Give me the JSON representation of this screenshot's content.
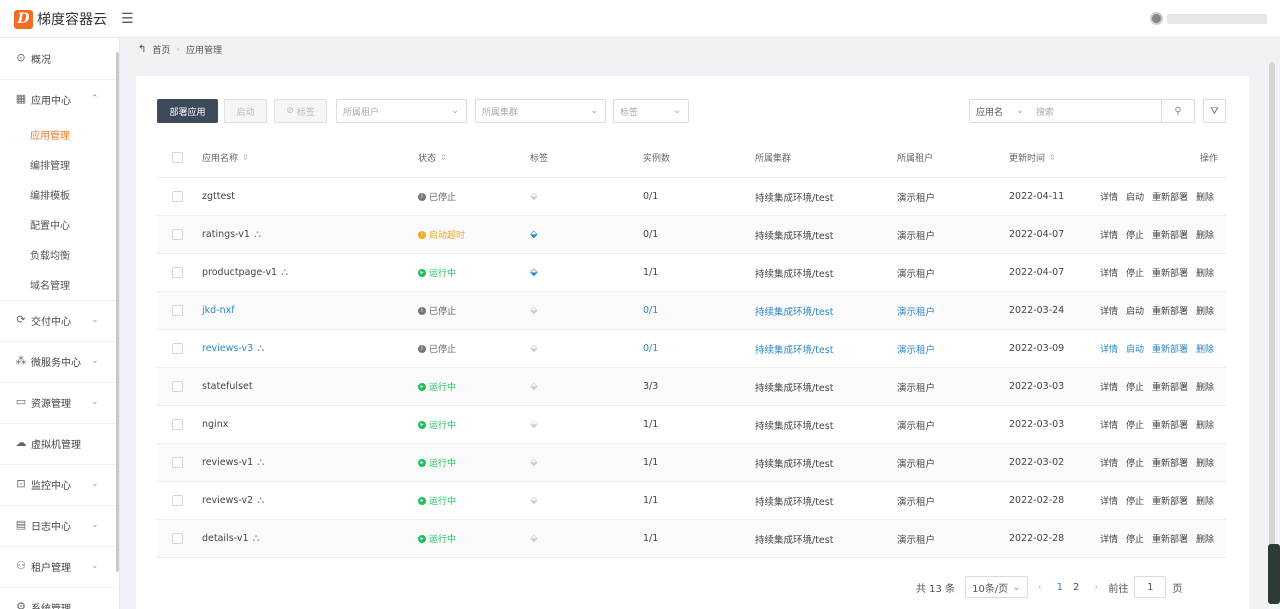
{
  "app": {
    "logo_char": "D",
    "title": "梯度容器云"
  },
  "sidebar": {
    "items": [
      {
        "label": "概况",
        "icon": "⊙"
      },
      {
        "label": "应用中心",
        "icon": "▦"
      },
      {
        "label": "交付中心",
        "icon": "⟳"
      },
      {
        "label": "微服务中心",
        "icon": "⁂"
      },
      {
        "label": "资源管理",
        "icon": "▭"
      },
      {
        "label": "虚拟机管理",
        "icon": "☁"
      },
      {
        "label": "监控中心",
        "icon": "⊡"
      },
      {
        "label": "日志中心",
        "icon": "▤"
      },
      {
        "label": "租户管理",
        "icon": "⚇"
      },
      {
        "label": "系统管理",
        "icon": "⚙"
      }
    ],
    "sub_items": [
      "应用管理",
      "编排管理",
      "编排模板",
      "配置中心",
      "负载均衡",
      "域名管理"
    ]
  },
  "breadcrumb": {
    "home": "首页",
    "current": "应用管理"
  },
  "toolbar": {
    "deploy": "部署应用",
    "start": "启动",
    "tag": "标签",
    "tenant_placeholder": "所属租户",
    "cluster_placeholder": "所属集群",
    "tag_placeholder": "标签",
    "search_type": "应用名",
    "search_placeholder": "搜索"
  },
  "table": {
    "headers": {
      "name": "应用名称",
      "status": "状态",
      "tag": "标签",
      "instances": "实例数",
      "cluster": "所属集群",
      "tenant": "所属租户",
      "updated": "更新时间",
      "ops": "操作"
    },
    "rows": [
      {
        "name": "zgttest",
        "pod": false,
        "status": "已停止",
        "state": "stopped",
        "tag_on": false,
        "instances": "0/1",
        "cluster": "持续集成环境/test",
        "tenant": "演示租户",
        "updated": "2022-04-11",
        "ops": [
          "详情",
          "启动",
          "重新部署",
          "删除"
        ]
      },
      {
        "name": "ratings-v1",
        "pod": true,
        "status": "启动超时",
        "state": "timeout",
        "tag_on": true,
        "instances": "0/1",
        "cluster": "持续集成环境/test",
        "tenant": "演示租户",
        "updated": "2022-04-07",
        "ops": [
          "详情",
          "停止",
          "重新部署",
          "删除"
        ]
      },
      {
        "name": "productpage-v1",
        "pod": true,
        "status": "运行中",
        "state": "running",
        "tag_on": true,
        "instances": "1/1",
        "cluster": "持续集成环境/test",
        "tenant": "演示租户",
        "updated": "2022-04-07",
        "ops": [
          "详情",
          "停止",
          "重新部署",
          "删除"
        ]
      },
      {
        "name": "jkd-nxf",
        "pod": false,
        "status": "已停止",
        "state": "stopped",
        "tag_on": false,
        "instances": "0/1",
        "cluster": "持续集成环境/test",
        "tenant": "演示租户",
        "updated": "2022-03-24",
        "ops": [
          "详情",
          "启动",
          "重新部署",
          "删除"
        ]
      },
      {
        "name": "reviews-v3",
        "pod": true,
        "status": "已停止",
        "state": "stopped",
        "tag_on": false,
        "instances": "0/1",
        "cluster": "持续集成环境/test",
        "tenant": "演示租户",
        "updated": "2022-03-09",
        "ops": [
          "详情",
          "启动",
          "重新部署",
          "删除"
        ]
      },
      {
        "name": "statefulset",
        "pod": false,
        "status": "运行中",
        "state": "running",
        "tag_on": false,
        "instances": "3/3",
        "cluster": "持续集成环境/test",
        "tenant": "演示租户",
        "updated": "2022-03-03",
        "ops": [
          "详情",
          "停止",
          "重新部署",
          "删除"
        ]
      },
      {
        "name": "nginx",
        "pod": false,
        "status": "运行中",
        "state": "running",
        "tag_on": false,
        "instances": "1/1",
        "cluster": "持续集成环境/test",
        "tenant": "演示租户",
        "updated": "2022-03-03",
        "ops": [
          "详情",
          "停止",
          "重新部署",
          "删除"
        ]
      },
      {
        "name": "reviews-v1",
        "pod": true,
        "status": "运行中",
        "state": "running",
        "tag_on": false,
        "instances": "1/1",
        "cluster": "持续集成环境/test",
        "tenant": "演示租户",
        "updated": "2022-03-02",
        "ops": [
          "详情",
          "停止",
          "重新部署",
          "删除"
        ]
      },
      {
        "name": "reviews-v2",
        "pod": true,
        "status": "运行中",
        "state": "running",
        "tag_on": false,
        "instances": "1/1",
        "cluster": "持续集成环境/test",
        "tenant": "演示租户",
        "updated": "2022-02-28",
        "ops": [
          "详情",
          "停止",
          "重新部署",
          "删除"
        ]
      },
      {
        "name": "details-v1",
        "pod": true,
        "status": "运行中",
        "state": "running",
        "tag_on": false,
        "instances": "1/1",
        "cluster": "持续集成环境/test",
        "tenant": "演示租户",
        "updated": "2022-02-28",
        "ops": [
          "详情",
          "停止",
          "重新部署",
          "删除"
        ]
      }
    ]
  },
  "pagination": {
    "total": "共 13 条",
    "page_size": "10条/页",
    "pages": [
      "1",
      "2"
    ],
    "current": "1",
    "goto_prefix": "前往",
    "goto_value": "1",
    "goto_suffix": "页"
  },
  "colors": {
    "accent": "#f07b2c",
    "primary_button": "#3d4a5c",
    "link": "#2a87c8",
    "running": "#1ec05d",
    "timeout": "#f5a623"
  }
}
